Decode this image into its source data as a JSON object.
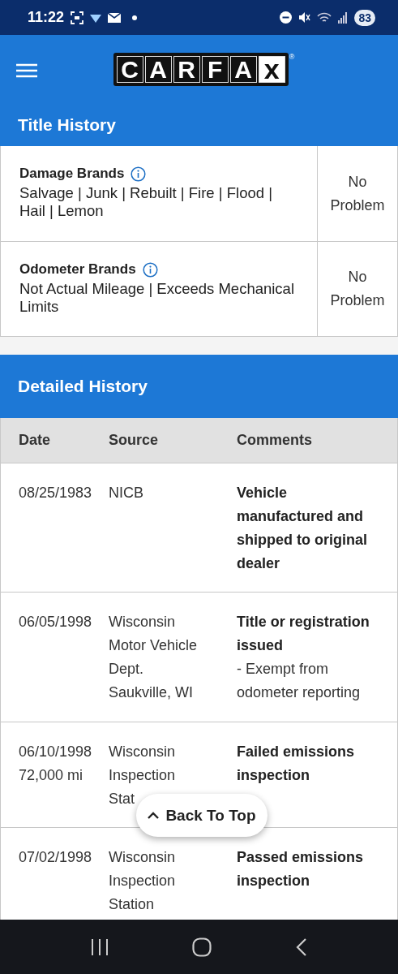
{
  "status_bar": {
    "time": "11:22",
    "battery": "83"
  },
  "header": {
    "logo_letters": [
      "C",
      "A",
      "R",
      "F",
      "A",
      "x"
    ],
    "logo_mark": "®"
  },
  "title_history": {
    "title": "Title History",
    "rows": [
      {
        "label": "Damage Brands",
        "detail": "Salvage | Junk | Rebuilt | Fire | Flood | Hail | Lemon",
        "status": "No Problem"
      },
      {
        "label": "Odometer Brands",
        "detail": "Not Actual Mileage | Exceeds Mechanical Limits",
        "status": "No Problem"
      }
    ]
  },
  "detailed_history": {
    "title": "Detailed History",
    "columns": [
      "Date",
      "Source",
      "Comments"
    ],
    "rows": [
      {
        "date": [
          "08/25/1983"
        ],
        "source": [
          "NICB"
        ],
        "comments": [
          {
            "kind": "title",
            "text": "Vehicle manufactured and shipped to original dealer"
          }
        ]
      },
      {
        "date": [
          "06/05/1998"
        ],
        "source": [
          "Wisconsin",
          "Motor Vehicle",
          "Dept.",
          "Saukville, WI"
        ],
        "comments": [
          {
            "kind": "title",
            "text": "Title or registration issued"
          },
          {
            "kind": "note",
            "text": "- Exempt from odometer reporting"
          }
        ]
      },
      {
        "date": [
          "06/10/1998",
          "72,000 mi"
        ],
        "source": [
          "Wisconsin",
          "Inspection",
          "Stat"
        ],
        "comments": [
          {
            "kind": "title",
            "text": "Failed emissions inspection"
          }
        ]
      },
      {
        "date": [
          "07/02/1998"
        ],
        "source": [
          "Wisconsin",
          "Inspection",
          "Station"
        ],
        "comments": [
          {
            "kind": "title",
            "text": "Passed emissions inspection"
          }
        ]
      }
    ]
  },
  "back_to_top": {
    "label": "Back To Top"
  }
}
